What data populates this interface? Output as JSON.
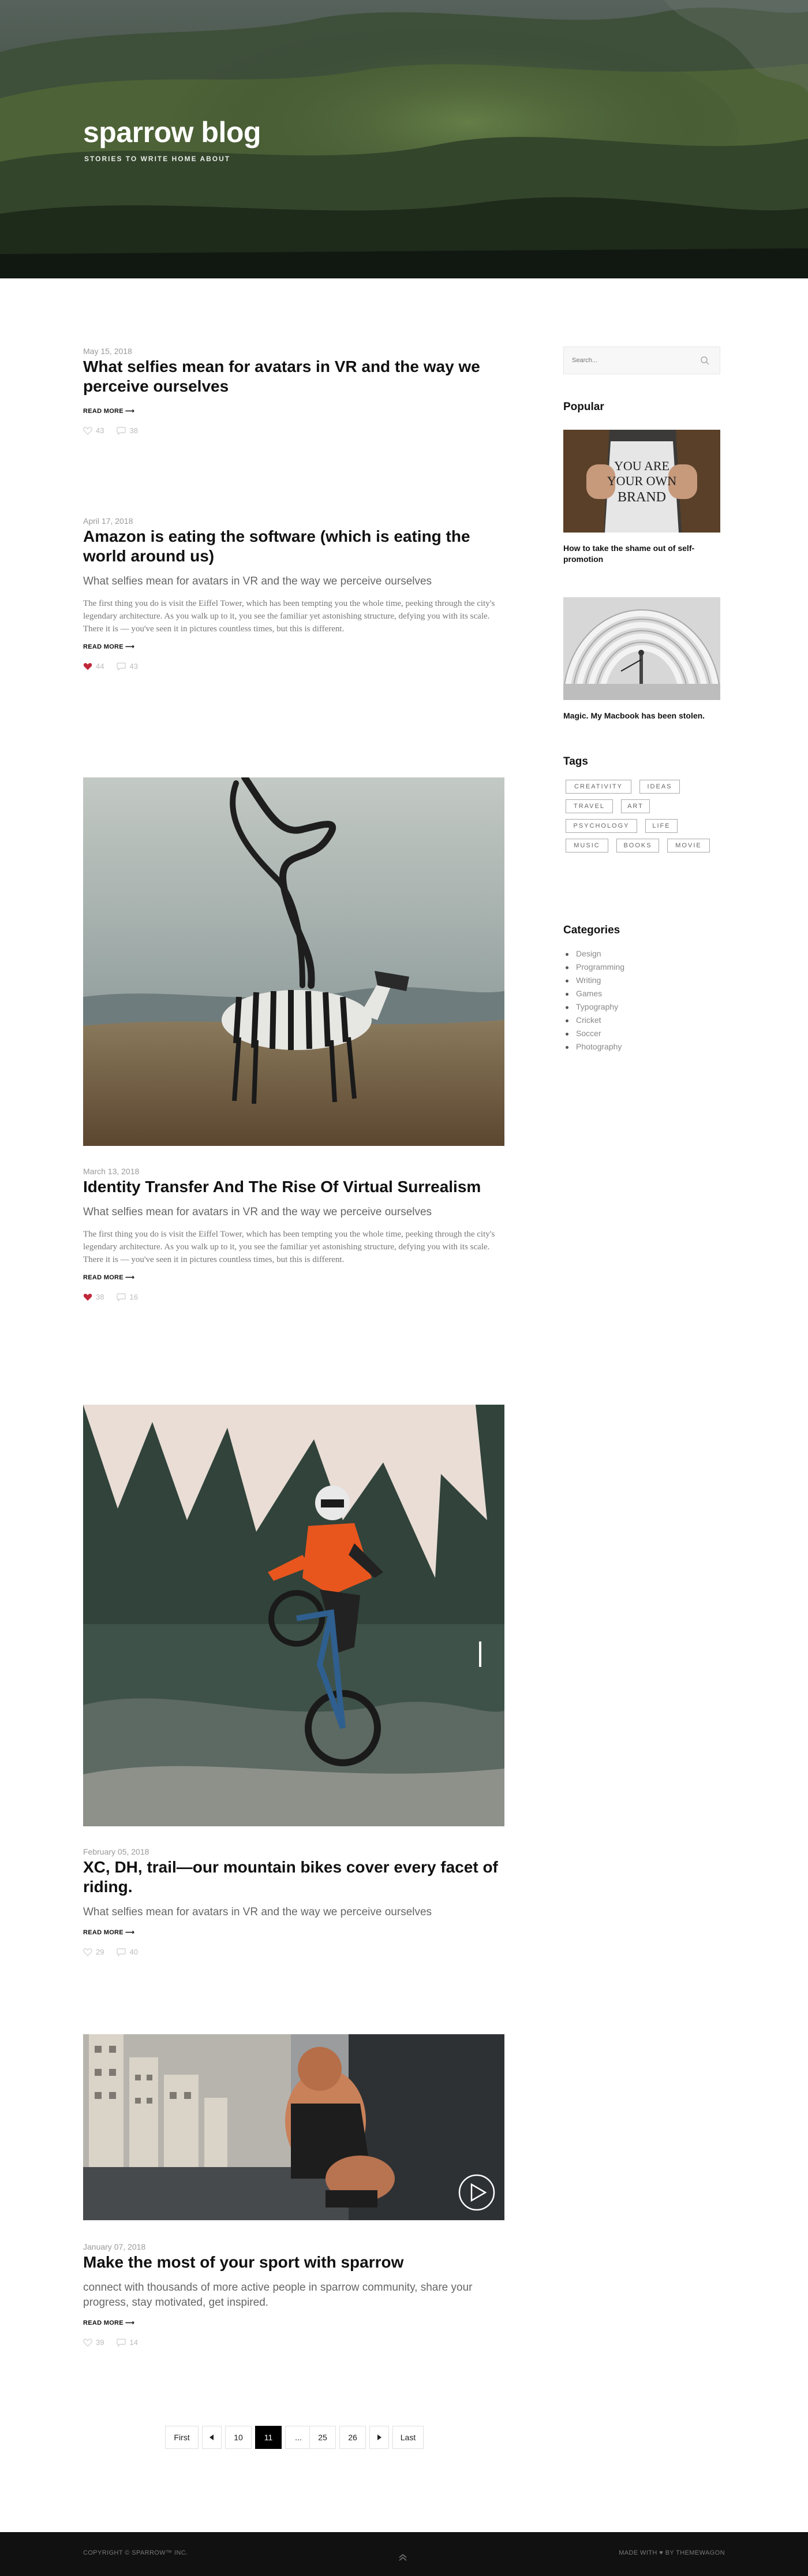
{
  "site": {
    "name": "sparrow blog",
    "tagline": "STORIES TO WRITE HOME ABOUT"
  },
  "posts": [
    {
      "date": "May 15, 2018",
      "title": "What selfies mean for avatars in VR and the way we perceive ourselves",
      "read_more": "READ MORE",
      "likes": "43",
      "comments": "38"
    },
    {
      "date": "April 17, 2018",
      "title": "Amazon is eating the software (which is eating the world around us)",
      "subtitle": "What selfies mean for avatars in VR and the way we perceive ourselves",
      "excerpt": "The first thing you do is visit the Eiffel Tower, which has been tempting you the whole time, peeking through the city's legendary architecture. As you walk up to it, you see the familiar yet astonishing structure, defying you with its scale. There it is — you've seen it in pictures countless times, but this is different.",
      "read_more": "READ MORE",
      "likes": "44",
      "comments": "43",
      "liked": true
    },
    {
      "date": "March 13, 2018",
      "title": "Identity Transfer And The Rise Of Virtual Surrealism",
      "subtitle": "What selfies mean for avatars in VR and the way we perceive ourselves",
      "excerpt": "The first thing you do is visit the Eiffel Tower, which has been tempting you the whole time, peeking through the city's legendary architecture. As you walk up to it, you see the familiar yet astonishing structure, defying you with its scale. There it is — you've seen it in pictures countless times, but this is different.",
      "read_more": "READ MORE",
      "likes": "38",
      "comments": "16",
      "liked": true
    },
    {
      "date": "February 05, 2018",
      "title": "XC, DH, trail—our mountain bikes cover every facet of riding.",
      "subtitle": "What selfies mean for avatars in VR and the way we perceive ourselves",
      "read_more": "READ MORE",
      "likes": "29",
      "comments": "40"
    },
    {
      "date": "January 07, 2018",
      "title": "Make the most of your sport with sparrow",
      "subtitle": "connect with thousands of more active people in sparrow community, share your progress, stay motivated, get inspired.",
      "read_more": "READ MORE",
      "likes": "39",
      "comments": "14"
    }
  ],
  "sidebar": {
    "search_placeholder": "Search...",
    "popular_title": "Popular",
    "popular": [
      {
        "title": "How to take the shame out of self-promotion",
        "shirt_text": [
          "YOU ARE",
          "YOUR OWN",
          "BRAND"
        ]
      },
      {
        "title": "Magic. My Macbook has been stolen."
      }
    ],
    "tags_title": "Tags",
    "tags": [
      "CREATIVITY",
      "IDEAS",
      "TRAVEL",
      "ART",
      "PSYCHOLOGY",
      "LIFE",
      "MUSIC",
      "BOOKS",
      "MOVIE"
    ],
    "categories_title": "Categories",
    "categories": [
      "Design",
      "Programming",
      "Writing",
      "Games",
      "Typography",
      "Cricket",
      "Soccer",
      "Photography"
    ]
  },
  "pagination": {
    "first": "First",
    "last": "Last",
    "pages": [
      "10",
      "11",
      "...",
      "25",
      "26"
    ],
    "active": "11"
  },
  "footer": {
    "copyright": "COPYRIGHT © SPARROW™ INC.",
    "made_with": "MADE WITH ♥ BY THEMEWAGON"
  },
  "colors": {
    "accent_heart": "#c0283a",
    "footer_bg": "#111111",
    "active_page": "#000000"
  }
}
